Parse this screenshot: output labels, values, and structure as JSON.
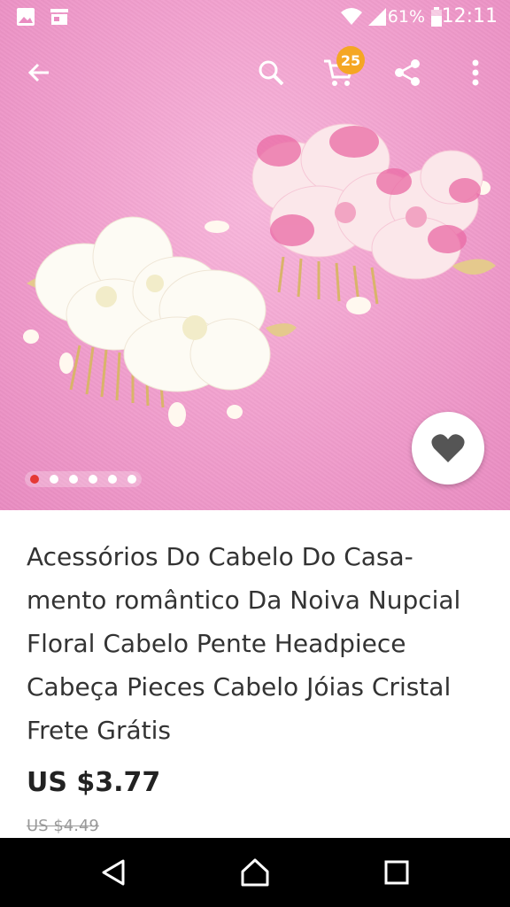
{
  "status_bar": {
    "battery_percent": "61%",
    "time": "12:11",
    "icons": [
      "image-icon",
      "store-icon",
      "wifi-icon",
      "signal-icon",
      "battery-icon"
    ]
  },
  "app_bar": {
    "icons": [
      "back-arrow-icon",
      "search-icon",
      "cart-icon",
      "share-icon",
      "more-vert-icon"
    ],
    "cart_count": "25"
  },
  "gallery": {
    "image_count": 6,
    "active_index": 0
  },
  "product": {
    "title_lines": [
      "Acessórios Do Cabelo Do Casa-",
      "mento romântico Da Noiva Nupcial",
      "Floral Cabelo Pente Headpiece",
      "Cabeça Pieces Cabelo Jóias Cristal",
      "Frete Grátis"
    ],
    "price": "US $3.77",
    "original_price": "US $4.49"
  },
  "nav_bar": {
    "icons": [
      "back-triangle-icon",
      "home-icon",
      "recents-icon"
    ]
  },
  "colors": {
    "accent_red": "#e53935",
    "badge_orange": "#f5a623",
    "hero_pink": "#f2a2cf"
  }
}
